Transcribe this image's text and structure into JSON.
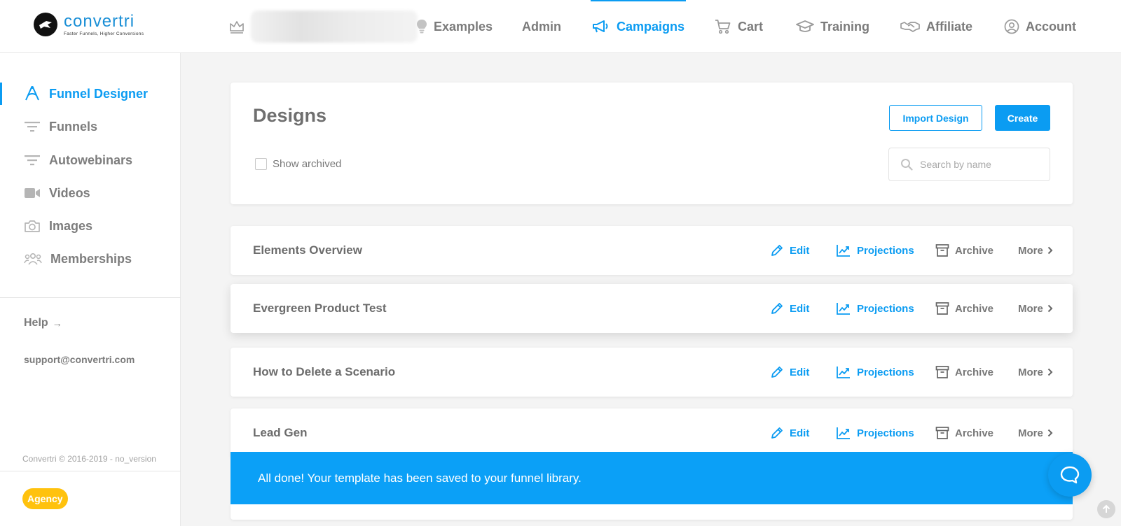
{
  "brand": {
    "name": "convertri",
    "tagline": "Faster Funnels, Higher Conversions",
    "accent_color": "#0b9cf2"
  },
  "topnav": {
    "items": [
      {
        "label": "Examples",
        "icon": "lightbulb-icon"
      },
      {
        "label": "Admin",
        "icon": ""
      },
      {
        "label": "Campaigns",
        "icon": "megaphone-icon",
        "active": true
      },
      {
        "label": "Cart",
        "icon": "cart-icon"
      },
      {
        "label": "Training",
        "icon": "graduation-cap-icon"
      },
      {
        "label": "Affiliate",
        "icon": "handshake-icon"
      },
      {
        "label": "Account",
        "icon": "user-circle-icon"
      }
    ]
  },
  "sidebar": {
    "items": [
      {
        "label": "Funnel Designer",
        "icon": "funnel-designer-icon",
        "active": true
      },
      {
        "label": "Funnels",
        "icon": "filter-icon"
      },
      {
        "label": "Autowebinars",
        "icon": "filter-icon"
      },
      {
        "label": "Videos",
        "icon": "video-camera-icon"
      },
      {
        "label": "Images",
        "icon": "camera-icon"
      },
      {
        "label": "Memberships",
        "icon": "users-icon"
      }
    ],
    "help_label": "Help",
    "support_email": "support@convertri.com",
    "copyright": "Convertri © 2016-2019 - no_version",
    "plan_badge": "Agency"
  },
  "designs": {
    "title": "Designs",
    "show_archived_label": "Show archived",
    "show_archived_checked": false,
    "import_label": "Import Design",
    "create_label": "Create",
    "search_placeholder": "Search by name"
  },
  "actions": {
    "edit": "Edit",
    "projections": "Projections",
    "archive": "Archive",
    "more": "More"
  },
  "rows": [
    {
      "name": "Elements Overview"
    },
    {
      "name": "Evergreen Product Test"
    },
    {
      "name": "How to Delete a Scenario"
    },
    {
      "name": "Lead Gen"
    }
  ],
  "toast": {
    "message": "All done! Your template has been saved to your funnel library."
  }
}
